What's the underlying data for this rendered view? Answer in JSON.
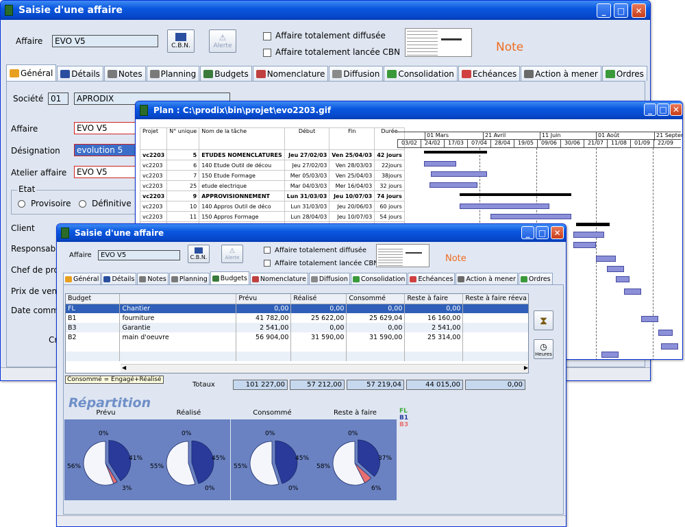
{
  "back_window": {
    "title": "Saisie d'une affaire",
    "affaire_label": "Affaire",
    "affaire_value": "EVO V5",
    "cbn_label": "C.B.N.",
    "alerte_label": "Alerte",
    "check1": "Affaire totalement diffusée",
    "check2": "Affaire totalement lancée CBN",
    "note": "Note",
    "tabs": [
      "Général",
      "Détails",
      "Notes",
      "Planning",
      "Budgets",
      "Nomenclature",
      "Diffusion",
      "Consolidation",
      "Echéances",
      "Action à mener",
      "Ordres"
    ],
    "societe_label": "Société",
    "societe_code": "01",
    "societe_name": "APRODIX",
    "fields": [
      {
        "label": "Affaire",
        "value": "EVO V5"
      },
      {
        "label": "Désignation",
        "value": "evolution 5"
      },
      {
        "label": "Atelier affaire",
        "value": "EVO V5"
      }
    ],
    "etat_label": "Etat",
    "radio1": "Provisoire",
    "radio2": "Définitive",
    "side_labels": [
      "Client",
      "Responsable",
      "Chef de proj",
      "Prix de vente",
      "Date comma"
    ],
    "bottom_partial": "Cr"
  },
  "plan_window": {
    "title": "Plan : C:\\prodix\\bin\\projet\\evo2203.gif",
    "headers": [
      "Projet",
      "N° unique",
      "Nom de la tâche",
      "Début",
      "Fin",
      "Durée"
    ],
    "rows": [
      {
        "projet": "vc2203",
        "num": "5",
        "nom": "ETUDES NOMENCLATURES",
        "debut": "Jeu 27/02/03",
        "fin": "Ven 25/04/03",
        "duree": "42 jours",
        "bold": true
      },
      {
        "projet": "vc2203",
        "num": "6",
        "nom": "140 Etude Outil de décou",
        "debut": "Jeu 27/02/03",
        "fin": "Ven 28/03/03",
        "duree": "22jours",
        "bold": false
      },
      {
        "projet": "vc2203",
        "num": "7",
        "nom": "150 Etude Formage",
        "debut": "Mer 05/03/03",
        "fin": "Ven 25/04/03",
        "duree": "38jours",
        "bold": false
      },
      {
        "projet": "vc2203",
        "num": "25",
        "nom": "etude electrique",
        "debut": "Mar 04/03/03",
        "fin": "Mer 16/04/03",
        "duree": "32 jours",
        "bold": false
      },
      {
        "projet": "vc2203",
        "num": "9",
        "nom": "APPROVISIONNEMENT",
        "debut": "Lun 31/03/03",
        "fin": "Jeu 10/07/03",
        "duree": "74 jours",
        "bold": true
      },
      {
        "projet": "vc2203",
        "num": "10",
        "nom": "140 Appros Outil de déco",
        "debut": "Lun 31/03/03",
        "fin": "Jeu 20/06/03",
        "duree": "60 jours",
        "bold": false
      },
      {
        "projet": "vc2203",
        "num": "11",
        "nom": "150 Appros Formage",
        "debut": "Lun 28/04/03",
        "fin": "Jeu 10/07/03",
        "duree": "54 jours",
        "bold": false
      }
    ],
    "months": [
      "01 Mars",
      "21 Avril",
      "11 Juin",
      "01 Août",
      "21 Septer"
    ],
    "weeks": [
      "03/02",
      "24/02",
      "17/03",
      "07/04",
      "28/04",
      "19/05",
      "09/06",
      "30/06",
      "21/07",
      "11/08",
      "01/09",
      "22/09"
    ]
  },
  "front_window": {
    "title": "Saisie d'une affaire",
    "affaire_label": "Affaire",
    "affaire_value": "EVO V5",
    "cbn_label": "C.B.N.",
    "alerte_label": "Alerte",
    "check1": "Affaire totalement diffusée",
    "check2": "Affaire totalement lancée CBN",
    "note": "Note",
    "tabs": [
      "Général",
      "Détails",
      "Notes",
      "Planning",
      "Budgets",
      "Nomenclature",
      "Diffusion",
      "Consolidation",
      "Echéances",
      "Action à mener",
      "Ordres"
    ],
    "table_headers": [
      "Budget",
      "",
      "Prévu",
      "Réalisé",
      "Consommé",
      "Reste à faire",
      "Reste à faire réeva"
    ],
    "table_rows": [
      {
        "code": "FL",
        "name": "Chantier",
        "prevu": "0,00",
        "realise": "0,00",
        "consomme": "0,00",
        "reste": "0,00",
        "reeval": ""
      },
      {
        "code": "B1",
        "name": "fourniture",
        "prevu": "41 782,00",
        "realise": "25 622,00",
        "consomme": "25 629,04",
        "reste": "16 160,00",
        "reeval": ""
      },
      {
        "code": "B3",
        "name": "Garantie",
        "prevu": "2 541,00",
        "realise": "0,00",
        "consomme": "0,00",
        "reste": "2 541,00",
        "reeval": ""
      },
      {
        "code": "B2",
        "name": "main d'oeuvre",
        "prevu": "56 904,00",
        "realise": "31 590,00",
        "consomme": "31 590,00",
        "reste": "25 314,00",
        "reeval": ""
      }
    ],
    "hint": "Consommé = Engagé+Réalisé",
    "totaux_label": "Totaux",
    "totals": [
      "101 227,00",
      "57 212,00",
      "57 219,04",
      "44 015,00",
      "0,00"
    ],
    "heures_label": "Heures",
    "repartition": "Répartition",
    "legend": [
      {
        "code": "FL",
        "color": "#3aa83a"
      },
      {
        "code": "B1",
        "color": "#2a3a9a"
      },
      {
        "code": "B3",
        "color": "#e87070"
      }
    ]
  },
  "chart_data": [
    {
      "type": "pie",
      "title": "Prévu",
      "labels": [
        "FL",
        "B1",
        "B3",
        "B2"
      ],
      "values": [
        0,
        41,
        3,
        56
      ]
    },
    {
      "type": "pie",
      "title": "Réalisé",
      "labels": [
        "FL",
        "B1",
        "B3",
        "B2"
      ],
      "values": [
        0,
        45,
        0,
        55
      ]
    },
    {
      "type": "pie",
      "title": "Consommé",
      "labels": [
        "FL",
        "B1",
        "B3",
        "B2"
      ],
      "values": [
        0,
        45,
        0,
        55
      ]
    },
    {
      "type": "pie",
      "title": "Reste à faire",
      "labels": [
        "FL",
        "B1",
        "B3",
        "B2"
      ],
      "values": [
        0,
        37,
        6,
        58
      ]
    }
  ]
}
